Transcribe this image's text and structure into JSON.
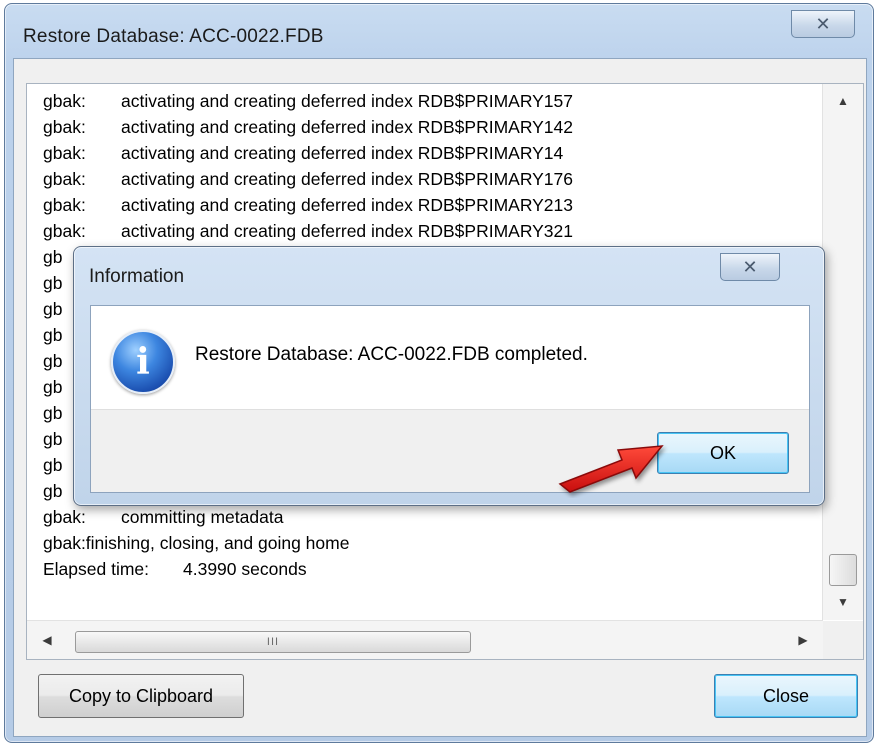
{
  "window": {
    "title": "Restore Database: ACC-0022.FDB",
    "close_glyph": "✕"
  },
  "log": {
    "lines": [
      {
        "prefix": "gbak:",
        "text": "activating and creating deferred index RDB$PRIMARY157"
      },
      {
        "prefix": "gbak:",
        "text": "activating and creating deferred index RDB$PRIMARY142"
      },
      {
        "prefix": "gbak:",
        "text": "activating and creating deferred index RDB$PRIMARY14"
      },
      {
        "prefix": "gbak:",
        "text": "activating and creating deferred index RDB$PRIMARY176"
      },
      {
        "prefix": "gbak:",
        "text": "activating and creating deferred index RDB$PRIMARY213"
      },
      {
        "prefix": "gbak:",
        "text": "activating and creating deferred index RDB$PRIMARY321"
      },
      {
        "prefix": "gb",
        "text": ""
      },
      {
        "prefix": "gb",
        "text": ""
      },
      {
        "prefix": "gb",
        "text": ""
      },
      {
        "prefix": "gb",
        "text": ""
      },
      {
        "prefix": "gb",
        "text": ""
      },
      {
        "prefix": "gb",
        "text": ""
      },
      {
        "prefix": "gb",
        "text": ""
      },
      {
        "prefix": "gb",
        "text": ""
      },
      {
        "prefix": "gb",
        "text": ""
      },
      {
        "prefix": "gb",
        "text": ""
      },
      {
        "prefix": "gbak:",
        "text": "committing metadata"
      },
      {
        "prefix": "gbak:finishing, closing, and going home",
        "text": ""
      },
      {
        "prefix": "Elapsed time:",
        "text": "4.3990 seconds"
      }
    ],
    "hscroll_grip": "III",
    "up_arrow": "▲",
    "down_arrow": "▼",
    "left_arrow": "◀",
    "right_arrow": "▶"
  },
  "buttons": {
    "copy": "Copy to Clipboard",
    "close": "Close"
  },
  "info_dialog": {
    "title": "Information",
    "close_glyph": "✕",
    "icon": "info-icon",
    "icon_glyph": "i",
    "message": "Restore Database: ACC-0022.FDB completed.",
    "ok": "OK"
  }
}
